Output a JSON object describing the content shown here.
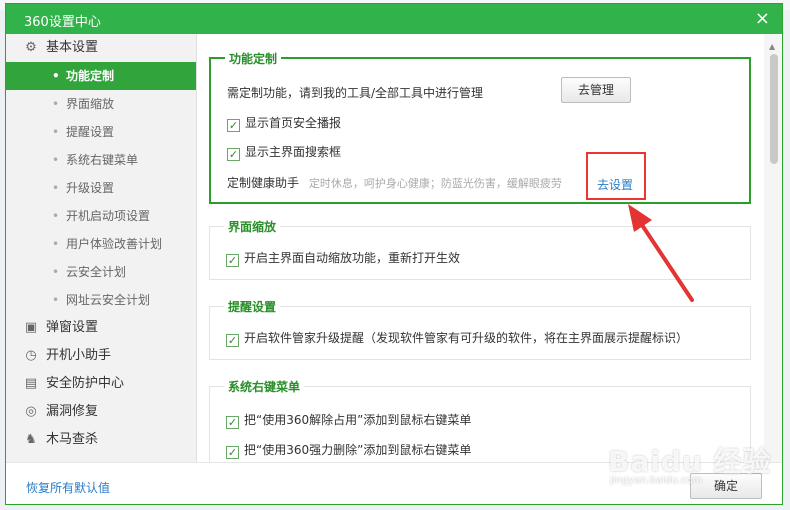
{
  "window": {
    "title": "360设置中心",
    "close": "×"
  },
  "sidebar": {
    "groups": [
      {
        "label": "基本设置",
        "icon": "gear-icon",
        "items": [
          "功能定制",
          "界面缩放",
          "提醒设置",
          "系统右键菜单",
          "升级设置",
          "开机启动项设置",
          "用户体验改善计划",
          "云安全计划",
          "网址云安全计划"
        ]
      },
      {
        "label": "弹窗设置",
        "icon": "popup-icon"
      },
      {
        "label": "开机小助手",
        "icon": "clock-icon"
      },
      {
        "label": "安全防护中心",
        "icon": "shield-icon"
      },
      {
        "label": "漏洞修复",
        "icon": "patch-icon"
      },
      {
        "label": "木马查杀",
        "icon": "horse-icon"
      }
    ],
    "active": "功能定制"
  },
  "sections": {
    "custom": {
      "title": "功能定制",
      "manage_text": "需定制功能，请到我的工具/全部工具中进行管理",
      "manage_button": "去管理",
      "cb1": "显示首页安全播报",
      "cb2": "显示主界面搜索框",
      "health_label": "定制健康助手",
      "health_desc": "定时休息，呵护身心健康；防蓝光伤害，缓解眼疲劳",
      "health_link": "去设置"
    },
    "zoom": {
      "title": "界面缩放",
      "cb1": "开启主界面自动缩放功能，重新打开生效"
    },
    "remind": {
      "title": "提醒设置",
      "cb1": "开启软件管家升级提醒（发现软件管家有可升级的软件，将在主界面展示提醒标识）"
    },
    "context": {
      "title": "系统右键菜单",
      "cb1": "把“使用360解除占用”添加到鼠标右键菜单",
      "cb2": "把“使用360强力删除”添加到鼠标右键菜单"
    }
  },
  "footer": {
    "restore": "恢复所有默认值",
    "ok": "确定"
  },
  "watermark": {
    "main": "Baidu 经验",
    "sub": "jingyan.baidu.com"
  },
  "colors": {
    "brand_green": "#31b24a",
    "annotation_red": "#e33333",
    "link_blue": "#2a7cc7"
  }
}
